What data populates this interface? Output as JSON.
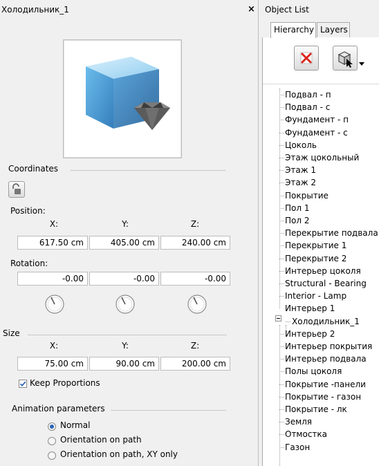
{
  "window": {
    "title": "Холодильник_1",
    "close_glyph": "×"
  },
  "coordinates": {
    "section_label": "Coordinates",
    "position_label": "Position:",
    "axis_labels": [
      "X:",
      "Y:",
      "Z:"
    ],
    "position": [
      "617.50 cm",
      "405.00 cm",
      "240.00 cm"
    ],
    "rotation_label": "Rotation:",
    "rotation": [
      "-0.00",
      "-0.00",
      "-0.00"
    ]
  },
  "size": {
    "section_label": "Size",
    "axis_labels": [
      "X:",
      "Y:",
      "Z:"
    ],
    "values": [
      "75.00 cm",
      "90.00 cm",
      "200.00 cm"
    ],
    "keep_proportions_label": "Keep Proportions",
    "keep_proportions_checked": true
  },
  "animation": {
    "section_label": "Animation parameters",
    "options": [
      "Normal",
      "Orientation on path",
      "Orientation on path, XY only"
    ],
    "selected": "Normal"
  },
  "object_list": {
    "title": "Object List",
    "tabs": [
      "Hierarchy",
      "Layers"
    ],
    "active_tab": "Hierarchy",
    "tree": [
      "Подвал - п",
      "Подвал - с",
      "Фундамент - п",
      "Фундамент - с",
      "Цоколь",
      "Этаж цокольный",
      "Этаж 1",
      "Этаж 2",
      "Покрытие",
      "Пол 1",
      "Пол 2",
      "Перекрытие подвала",
      "Перекрытие 1",
      "Перекрытие 2",
      "Интерьер цоколя",
      "Structural - Bearing",
      "Interior - Lamp",
      "Интерьер 1",
      "Холодильник_1",
      "Интерьер 2",
      "Интерьер покрытия",
      "Интерьер подвала",
      "Полы цоколя",
      "Покрытие -панели",
      "Покрытие - газон",
      "Покрытие - лк",
      "Земля",
      "Отмостка",
      "Газон"
    ],
    "expanded_node": "Интерьер 1",
    "child_node": "Холодильник_1"
  },
  "colors": {
    "accent_blue": "#2b64b8",
    "delete_red": "#d9261c"
  }
}
